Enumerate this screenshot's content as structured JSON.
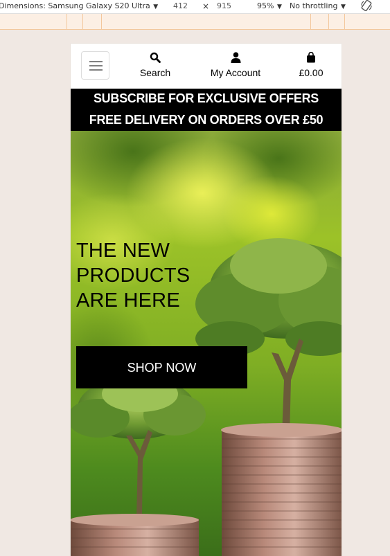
{
  "devtools": {
    "dimensions_label": "Dimensions: Samsung Galaxy S20 Ultra",
    "width": "412",
    "times": "×",
    "height": "915",
    "zoom": "95%",
    "throttling": "No throttling",
    "caret": "▼",
    "rotate_icon": "rotate-icon"
  },
  "header": {
    "menu_icon": "hamburger-icon",
    "search_label": "Search",
    "search_icon": "search-icon",
    "account_label": "My Account",
    "account_icon": "user-icon",
    "bag_total": "£0.00",
    "bag_icon": "shopping-bag-icon"
  },
  "banner": {
    "line1": "SUBSCRIBE FOR EXCLUSIVE OFFERS",
    "line2": "FREE DELIVERY ON ORDERS OVER £50"
  },
  "hero": {
    "title_lines": [
      "THE NEW",
      "PRODUCTS",
      "ARE HERE"
    ],
    "cta_label": "SHOP NOW"
  },
  "colors": {
    "page_background": "#f0e8e3",
    "banner_background": "#000000",
    "cta_background": "#000000",
    "ruler": "#fcefe4"
  }
}
